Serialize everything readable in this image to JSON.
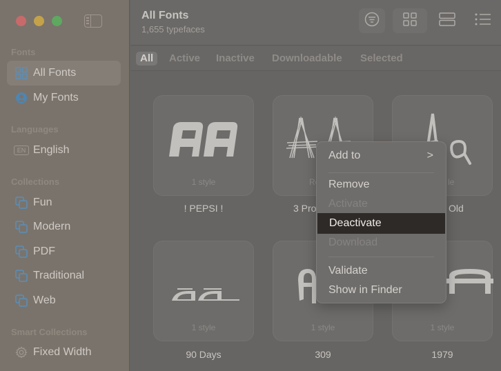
{
  "window": {
    "traffic_lights": {
      "close": "#c86a6a",
      "minimize": "#c4a24a",
      "zoom": "#5ea860"
    }
  },
  "sidebar": {
    "toggle_icon": "sidebar-toggle-icon",
    "sections": [
      {
        "label": "Fonts",
        "items": [
          {
            "label": "All Fonts",
            "icon": "grid-icon",
            "active": true
          },
          {
            "label": "My Fonts",
            "icon": "user-circle-icon",
            "active": false
          }
        ]
      },
      {
        "label": "Languages",
        "items": [
          {
            "label": "English",
            "icon": "language-badge-icon",
            "badge": "EN"
          }
        ]
      },
      {
        "label": "Collections",
        "items": [
          {
            "label": "Fun",
            "icon": "collection-icon"
          },
          {
            "label": "Modern",
            "icon": "collection-icon"
          },
          {
            "label": "PDF",
            "icon": "collection-icon"
          },
          {
            "label": "Traditional",
            "icon": "collection-icon"
          },
          {
            "label": "Web",
            "icon": "collection-icon"
          }
        ]
      },
      {
        "label": "Smart Collections",
        "items": [
          {
            "label": "Fixed Width",
            "icon": "gear-icon"
          }
        ]
      }
    ]
  },
  "header": {
    "title": "All Fonts",
    "subtitle": "1,655 typefaces",
    "toolbar": [
      {
        "name": "filter",
        "icon": "filter-icon"
      },
      {
        "name": "grid-view",
        "icon": "grid-view-icon",
        "selected": true
      },
      {
        "name": "strip-view",
        "icon": "strip-view-icon"
      },
      {
        "name": "list-view",
        "icon": "list-view-icon"
      }
    ]
  },
  "filters": {
    "tabs": [
      "All",
      "Active",
      "Inactive",
      "Downloadable",
      "Selected"
    ],
    "active": "All"
  },
  "fonts": [
    {
      "name": "! PEPSI !",
      "styles": "1 style",
      "preview": "AA"
    },
    {
      "name": "3 Pro",
      "styles": "Re",
      "preview": "AA"
    },
    {
      "name": "Old",
      "styles": "le",
      "preview": "Aa"
    },
    {
      "name": "90 Days",
      "styles": "1 style",
      "preview": "aa"
    },
    {
      "name": "309",
      "styles": "1 style",
      "preview": "A"
    },
    {
      "name": "1979",
      "styles": "1 style",
      "preview": "A"
    }
  ],
  "context_menu": {
    "items": [
      {
        "label": "Add to",
        "submenu": true,
        "chevron": ">"
      },
      {
        "separator": true
      },
      {
        "label": "Remove"
      },
      {
        "label": "Activate",
        "disabled": true
      },
      {
        "label": "Deactivate",
        "highlighted": true
      },
      {
        "label": "Download",
        "disabled": true
      },
      {
        "separator": true
      },
      {
        "label": "Validate"
      },
      {
        "label": "Show in Finder"
      }
    ]
  }
}
